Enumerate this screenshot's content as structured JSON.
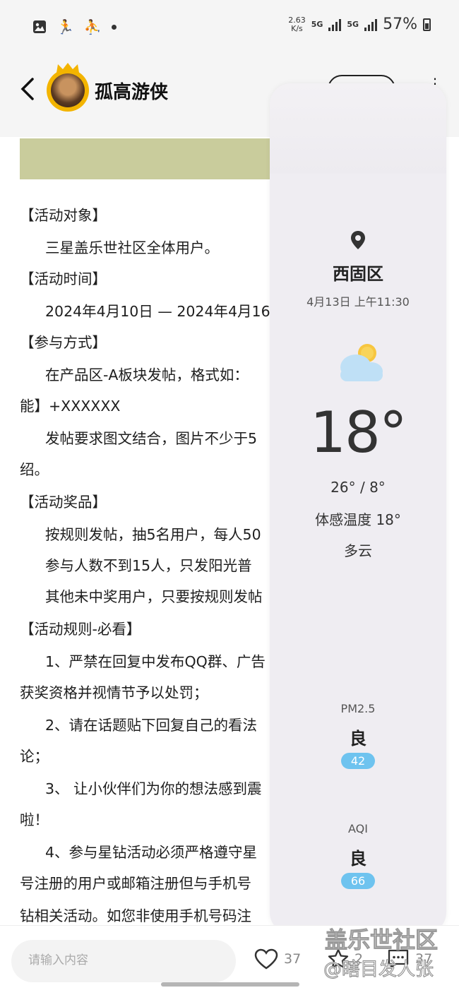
{
  "status_bar": {
    "speed_value": "2.63",
    "speed_unit": "K/s",
    "network_1": "5G",
    "network_2": "5G",
    "battery": "57%"
  },
  "header": {
    "username": "孤高游侠"
  },
  "article": {
    "lines": [
      "【活动对象】",
      "三星盖乐世社区全体用户。",
      "【活动时间】",
      "2024年4月10日 — 2024年4月16",
      "【参与方式】",
      "在产品区-A板块发帖，格式如：",
      "能】+XXXXXX",
      "发帖要求图文结合，图片不少于5",
      "绍。",
      "【活动奖品】",
      "按规则发帖，抽5名用户，每人50",
      "参与人数不到15人，只发阳光普",
      "其他未中奖用户，只要按规则发帖",
      "【活动规则-必看】",
      "1、严禁在回复中发布QQ群、广告",
      "获奖资格并视情节予以处罚；",
      "2、请在话题贴下回复自己的看法",
      "论；",
      "3、 让小伙伴们为你的想法感到震",
      "啦！",
      "4、参与星钻活动必须严格遵守星",
      "号注册的用户或邮箱注册但与手机号",
      "钻相关活动。如您非使用手机号码注"
    ]
  },
  "weather": {
    "location": "西固区",
    "datetime": "4月13日 上午11:30",
    "temperature": "18°",
    "range": "26° / 8°",
    "feels_like": "体感温度 18°",
    "condition": "多云",
    "pm25_label": "PM2.5",
    "pm25_grade": "良",
    "pm25_value": "42",
    "aqi_label": "AQI",
    "aqi_grade": "良",
    "aqi_value": "66",
    "badge_color": "#6ec3ef"
  },
  "bottom_bar": {
    "input_placeholder": "请输入内容",
    "likes": "37",
    "stars": "2",
    "comments": "37"
  },
  "watermark": {
    "line1": "盖乐世社区",
    "line2": "@瞎目发人张"
  }
}
